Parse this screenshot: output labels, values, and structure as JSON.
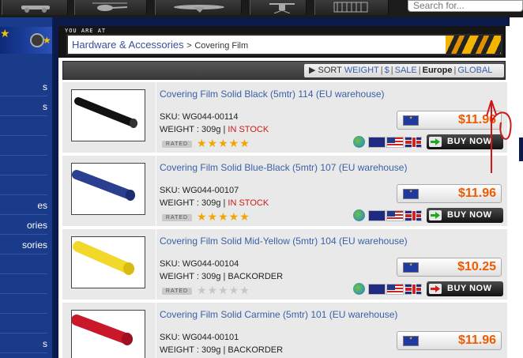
{
  "search": {
    "placeholder": "Search for..."
  },
  "top_categories": [
    "car-icon",
    "helicopter-icon",
    "plane-icon",
    "quadcopter-icon",
    "accessories-icon"
  ],
  "sidebar": {
    "items": [
      {
        "label": "s"
      },
      {
        "label": "s"
      },
      {
        "label": ""
      },
      {
        "label": ""
      },
      {
        "label": ""
      },
      {
        "label": ""
      },
      {
        "label": "es"
      },
      {
        "label": "ories"
      },
      {
        "label": "sories"
      },
      {
        "label": ""
      },
      {
        "label": ""
      },
      {
        "label": ""
      },
      {
        "label": ""
      },
      {
        "label": "s"
      }
    ]
  },
  "breadcrumb": {
    "tag": "YOU ARE AT",
    "parent": "Hardware & Accessories",
    "separator": ">",
    "current": "Covering Film"
  },
  "sort": {
    "label": "SORT",
    "weight": "WEIGHT",
    "dollar": "$",
    "sale": "SALE",
    "europe": "Europe",
    "global": "GLOBAL",
    "sep": "|"
  },
  "rated_label": "RATED",
  "buy_label": "BUY NOW",
  "products": [
    {
      "title": "Covering Film Solid Black (5mtr) 114 (EU warehouse)",
      "sku": "SKU: WG044-00114",
      "weight": "WEIGHT : 309g | ",
      "stock": "IN STOCK",
      "stars": "★★★★★",
      "price": "$11.96",
      "color": "#111111",
      "in_stock": true
    },
    {
      "title": "Covering Film Solid Blue-Black (5mtr) 107 (EU warehouse)",
      "sku": "SKU: WG044-00107",
      "weight": "WEIGHT : 309g | ",
      "stock": "IN STOCK",
      "stars": "★★★★★",
      "price": "$11.96",
      "color": "#2a3f8f",
      "in_stock": true
    },
    {
      "title": "Covering Film Solid Mid-Yellow (5mtr) 104 (EU warehouse)",
      "sku": "SKU: WG044-00104",
      "weight": "WEIGHT : 309g | ",
      "stock": "BACKORDER",
      "stars": "★★★★★",
      "price": "$10.25",
      "color": "#f2d82a",
      "in_stock": false
    },
    {
      "title": "Covering Film Solid Carmine (5mtr) 101 (EU warehouse)",
      "sku": "SKU: WG044-00101",
      "weight": "WEIGHT : 309g | ",
      "stock": "BACKORDER",
      "stars": "★★★★★",
      "price": "$11.96",
      "color": "#c8182a",
      "in_stock": false
    }
  ],
  "colors": {
    "price": "#f05a00",
    "link": "#3a5fa8",
    "in_stock": "#cc1a1a",
    "star": "#f2a400",
    "sidebar": "#1a3a8a"
  }
}
